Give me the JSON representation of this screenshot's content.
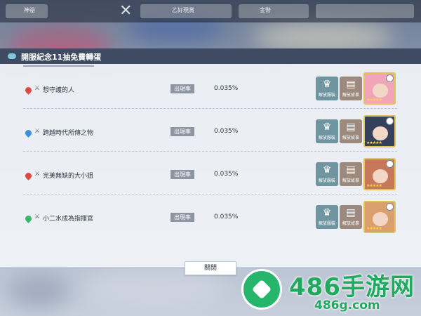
{
  "topbar": {
    "left_label": "神祕",
    "resource_1": "乙好現賞",
    "resource_2": "金幣"
  },
  "modal": {
    "title": "開服紀念11抽免費轉蛋",
    "close_label": "關閉",
    "rate_label": "出現率",
    "outfit_button_label": "解放服裝",
    "story_button_label": "解放故事",
    "rows": [
      {
        "name": "想守護的人",
        "rate": "0.035%",
        "rarity_color": "#e0483e",
        "portrait_color": "#f2a5b8",
        "stars": "★★★★★"
      },
      {
        "name": "跨越時代所傳之物",
        "rate": "0.035%",
        "rarity_color": "#3a8fd8",
        "portrait_color": "#35405c",
        "stars": "★★★★★"
      },
      {
        "name": "完美無缺的大小姐",
        "rate": "0.035%",
        "rarity_color": "#e0483e",
        "portrait_color": "#c8785a",
        "stars": "★★★★★"
      },
      {
        "name": "小二水成為指揮官",
        "rate": "0.035%",
        "rarity_color": "#3bb56a",
        "portrait_color": "#d9a06e",
        "stars": "★★★★★"
      }
    ]
  },
  "icons": {
    "header": "chat-bubble-icon",
    "rarity": "flame-icon",
    "type": "sword-icon",
    "outfit": "dress-icon",
    "story": "book-icon"
  },
  "watermark": {
    "main": "486手游网",
    "sub": "486g.com"
  }
}
